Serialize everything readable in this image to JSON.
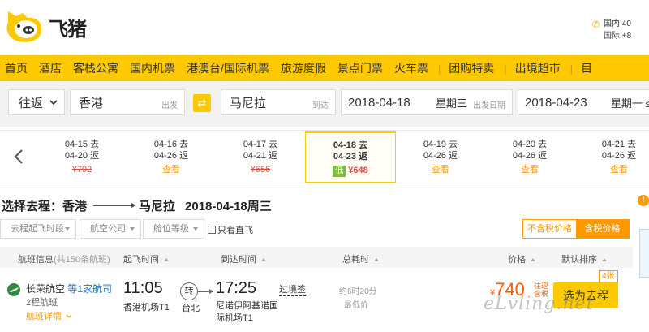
{
  "header": {
    "logo_text": "飞猪",
    "phone_lines": [
      "国内 40",
      "国际 +8"
    ]
  },
  "nav": {
    "items": [
      "首页",
      "酒店",
      "客栈公寓",
      "国内机票",
      "港澳台/国际机票",
      "旅游度假",
      "景点门票",
      "火车票",
      "团购特卖",
      "出境超市",
      "目"
    ]
  },
  "search": {
    "trip_type": "往返",
    "from_city": "香港",
    "from_hint": "出发",
    "to_city": "马尼拉",
    "to_hint": "到达",
    "depart_date": "2018-04-18",
    "depart_weekday": "星期三",
    "depart_hint": "出发日期",
    "return_date": "2018-04-23",
    "return_weekday": "星期一 ≤"
  },
  "date_options": [
    {
      "go": "04-15 去",
      "back": "04-20 返",
      "price": "¥792",
      "check": ""
    },
    {
      "go": "04-16 去",
      "back": "04-26 返",
      "price": "",
      "check": "查看"
    },
    {
      "go": "04-17 去",
      "back": "04-21 返",
      "price": "¥656",
      "check": ""
    },
    {
      "go": "04-18 去",
      "back": "04-23 返",
      "price": "¥648",
      "check": "",
      "low": "低"
    },
    {
      "go": "04-19 去",
      "back": "04-26 返",
      "price": "",
      "check": "查看"
    },
    {
      "go": "04-20 去",
      "back": "04-26 返",
      "price": "",
      "check": "查看"
    },
    {
      "go": "04-21 去",
      "back": "04-26 返",
      "price": "",
      "check": "查看"
    }
  ],
  "route": {
    "prefix": "选择去程：香港",
    "dest": "马尼拉",
    "date": "2018-04-18周三"
  },
  "filters": {
    "depart_time": "去程起飞时段",
    "airline": "航空公司",
    "cabin": "舱位等级",
    "direct_only": "只看直飞",
    "tax_excluded": "不含税价格",
    "tax_included": "含税价格"
  },
  "table_header": {
    "flight_info": "航班信息",
    "flight_count": "(共150条航班)",
    "depart_time": "起飞时间",
    "arrive_time": "到达时间",
    "duration": "总耗时",
    "price": "价格",
    "default_sort": "默认排序"
  },
  "flight": {
    "airline": "长荣航空",
    "airline_more": "等1家航司",
    "legs": "2程航班",
    "detail": "航班详情",
    "dep_time": "11:05",
    "dep_airport": "香港机场T1",
    "stop_label": "转",
    "stop_city": "台北",
    "arr_time": "17:25",
    "arr_airport": "尼诺伊阿基诺国际机场T1",
    "visa": "过境签",
    "duration": "约6时20分",
    "lowest": "最低价",
    "price_currency": "¥",
    "price": "740",
    "price_note": [
      "往返",
      "含税"
    ],
    "ticket_badge": "4张",
    "choose_label": "选为去程"
  },
  "watermark": "eLvling.net",
  "colors": {
    "brand_yellow": "#ffc900",
    "accent_orange": "#ff9900",
    "price_red": "#ff5a00"
  }
}
